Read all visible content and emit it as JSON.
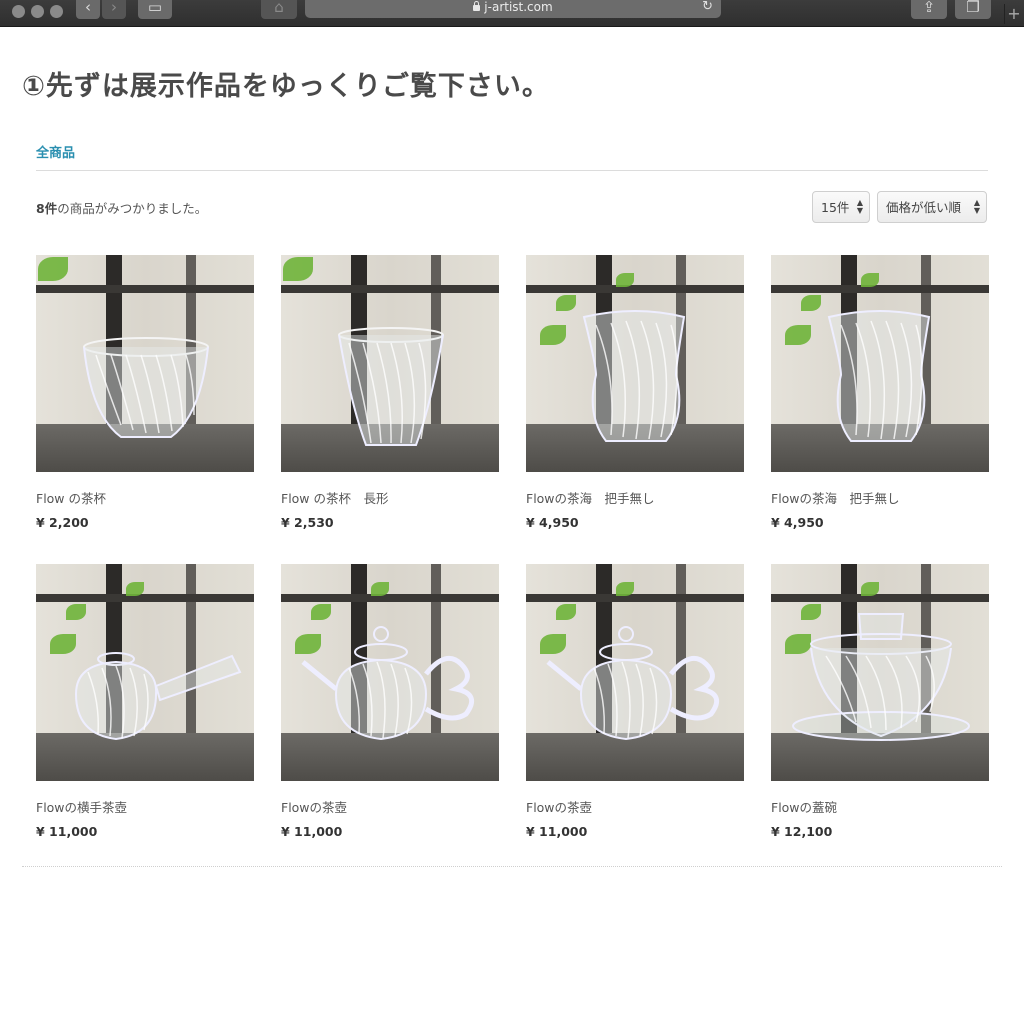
{
  "browser": {
    "url": "j-artist.com"
  },
  "page": {
    "headline": "①先ずは展示作品をゆっくりご覧下さい。",
    "tab_all": "全商品",
    "count_number": "8件",
    "count_text": "の商品がみつかりました。",
    "per_page": "15件",
    "sort": "価格が低い順"
  },
  "products": [
    {
      "name": "Flow の茶杯",
      "price": "¥ 2,200",
      "shape": "cup"
    },
    {
      "name": "Flow の茶杯　長形",
      "price": "¥ 2,530",
      "shape": "tallcup"
    },
    {
      "name": "Flowの茶海　把手無し",
      "price": "¥ 4,950",
      "shape": "pitcher"
    },
    {
      "name": "Flowの茶海　把手無し",
      "price": "¥ 4,950",
      "shape": "pitcher"
    },
    {
      "name": "Flowの横手茶壺",
      "price": "¥ 11,000",
      "shape": "sidepot"
    },
    {
      "name": "Flowの茶壺",
      "price": "¥ 11,000",
      "shape": "teapot"
    },
    {
      "name": "Flowの茶壺",
      "price": "¥ 11,000",
      "shape": "teapot"
    },
    {
      "name": "Flowの蓋碗",
      "price": "¥ 12,100",
      "shape": "gaiwan"
    }
  ]
}
